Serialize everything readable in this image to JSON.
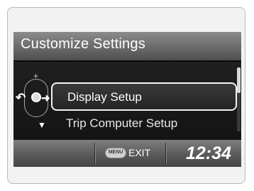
{
  "screen": {
    "title": "Customize Settings",
    "menu": {
      "items": [
        {
          "label": "Display Setup",
          "selected": true
        },
        {
          "label": "Trip Computer Setup",
          "selected": false
        }
      ]
    },
    "footer": {
      "menu_button_label": "MENU",
      "exit_label": "EXIT",
      "clock": "12:34"
    }
  },
  "icons": {
    "dial": "selector-dial-icon",
    "back": "back-arrow-icon",
    "enter": "enter-arrow-icon",
    "up": "plus-icon",
    "down": "down-triangle-icon"
  }
}
